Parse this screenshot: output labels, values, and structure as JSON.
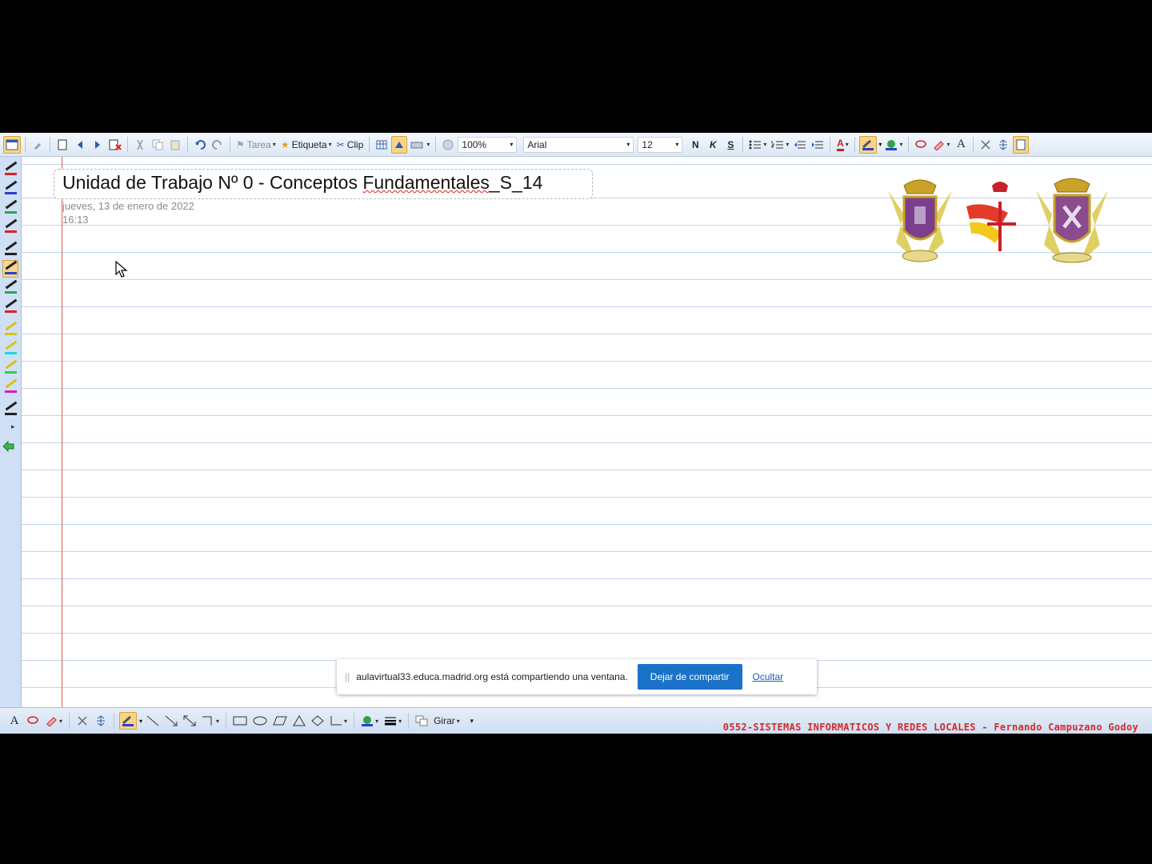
{
  "toolbar": {
    "task_label": "Tarea",
    "tag_label": "Etiqueta",
    "clip_label": "Clip",
    "zoom_value": "100%",
    "font_value": "Arial",
    "size_value": "12",
    "bold_label": "N",
    "italic_label": "K",
    "strike_label": "S",
    "text_style_label": "A",
    "font_color_label": "A"
  },
  "note": {
    "title_prefix": "Unidad de Trabajo Nº 0 - Conceptos ",
    "title_underlined": "Fundamentales",
    "title_suffix": "_S_14",
    "date": "jueves, 13 de enero de 2022",
    "time": "16:13"
  },
  "share_banner": {
    "message": "aulavirtual33.educa.madrid.org está compartiendo una ventana.",
    "stop_button": "Dejar de compartir",
    "hide_link": "Ocultar"
  },
  "bottom_toolbar": {
    "text_style_label": "A",
    "rotate_label": "Girar"
  },
  "footer": {
    "credit": "0552-SISTEMAS INFORMATICOS Y REDES LOCALES - Fernando Campuzano Godoy"
  },
  "colors": {
    "accent_button": "#1a73c8",
    "margin_line": "#e25b5b",
    "rule_line": "#c3d6e8",
    "credit_text": "#d42a2a"
  }
}
